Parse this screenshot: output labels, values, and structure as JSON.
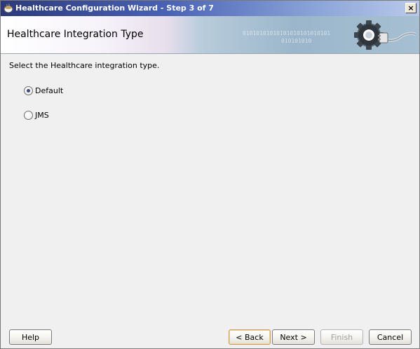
{
  "window": {
    "title": "Healthcare Configuration Wizard - Step 3 of 7",
    "close_glyph": "×"
  },
  "header": {
    "title": "Healthcare Integration Type",
    "binary_line1": "01010101010101010101010101",
    "binary_line2": "010101010"
  },
  "content": {
    "instruction": "Select the Healthcare integration type.",
    "options": [
      {
        "label": "Default",
        "checked": true
      },
      {
        "label": "JMS",
        "checked": false
      }
    ]
  },
  "buttons": {
    "help": "Help",
    "back": "< Back",
    "next": "Next >",
    "finish": "Finish",
    "cancel": "Cancel"
  },
  "icons": {
    "title_icon": "oracle-coffee-cup-icon",
    "header_icon": "gear-plug-icon"
  },
  "colors": {
    "titlebar_start": "#2c3a7c",
    "titlebar_end": "#b9c9ea",
    "radio_dot": "#3a4a88",
    "default_button_border": "#c8a060"
  }
}
